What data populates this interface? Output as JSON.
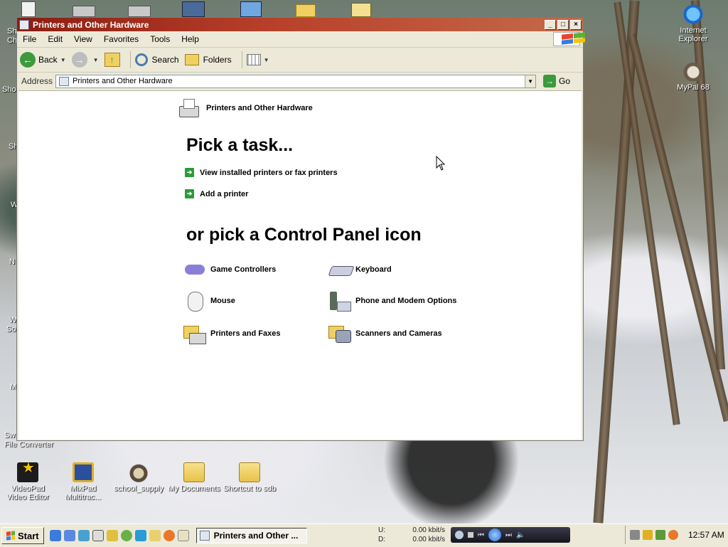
{
  "window": {
    "title": "Printers and Other Hardware",
    "controls": [
      "_",
      "□",
      "×"
    ]
  },
  "menu": [
    "File",
    "Edit",
    "View",
    "Favorites",
    "Tools",
    "Help"
  ],
  "toolbar": {
    "back_label": "Back",
    "search_label": "Search",
    "folders_label": "Folders"
  },
  "address": {
    "label": "Address",
    "value": "Printers and Other Hardware",
    "go_label": "Go"
  },
  "content": {
    "category_title": "Printers and Other Hardware",
    "heading_tasks": "Pick a task...",
    "tasks": [
      "View installed printers or fax printers",
      "Add a printer"
    ],
    "heading_icons": "or pick a Control Panel icon",
    "icons": [
      {
        "label": "Game Controllers",
        "icon": "game-controller-icon"
      },
      {
        "label": "Keyboard",
        "icon": "keyboard-icon"
      },
      {
        "label": "Mouse",
        "icon": "mouse-icon"
      },
      {
        "label": "Phone and Modem Options",
        "icon": "phone-modem-icon"
      },
      {
        "label": "Printers and Faxes",
        "icon": "printers-faxes-icon"
      },
      {
        "label": "Scanners and Cameras",
        "icon": "scanner-camera-icon"
      }
    ]
  },
  "desktop": {
    "icons_right": [
      {
        "label": "Internet Explorer"
      },
      {
        "label": "MyPal 68"
      }
    ],
    "icons_bottom": [
      {
        "label": "VideoPad Video Editor"
      },
      {
        "label": "MixPad Multitrac..."
      },
      {
        "label": "school_supply"
      },
      {
        "label": "My Documents"
      },
      {
        "label": "Shortcut to sdb"
      }
    ],
    "edge_labels": [
      "Sh",
      "Ch",
      "Sho",
      "Sh",
      "W",
      "N",
      "W",
      "So",
      "M",
      "Sw",
      "File Converter"
    ]
  },
  "taskbar": {
    "start_label": "Start",
    "task_label": "Printers and Other ...",
    "net_up_label": "U:",
    "net_down_label": "D:",
    "net_up": "0.00 kbit/s",
    "net_down": "0.00 kbit/s",
    "clock": "12:57 AM"
  }
}
